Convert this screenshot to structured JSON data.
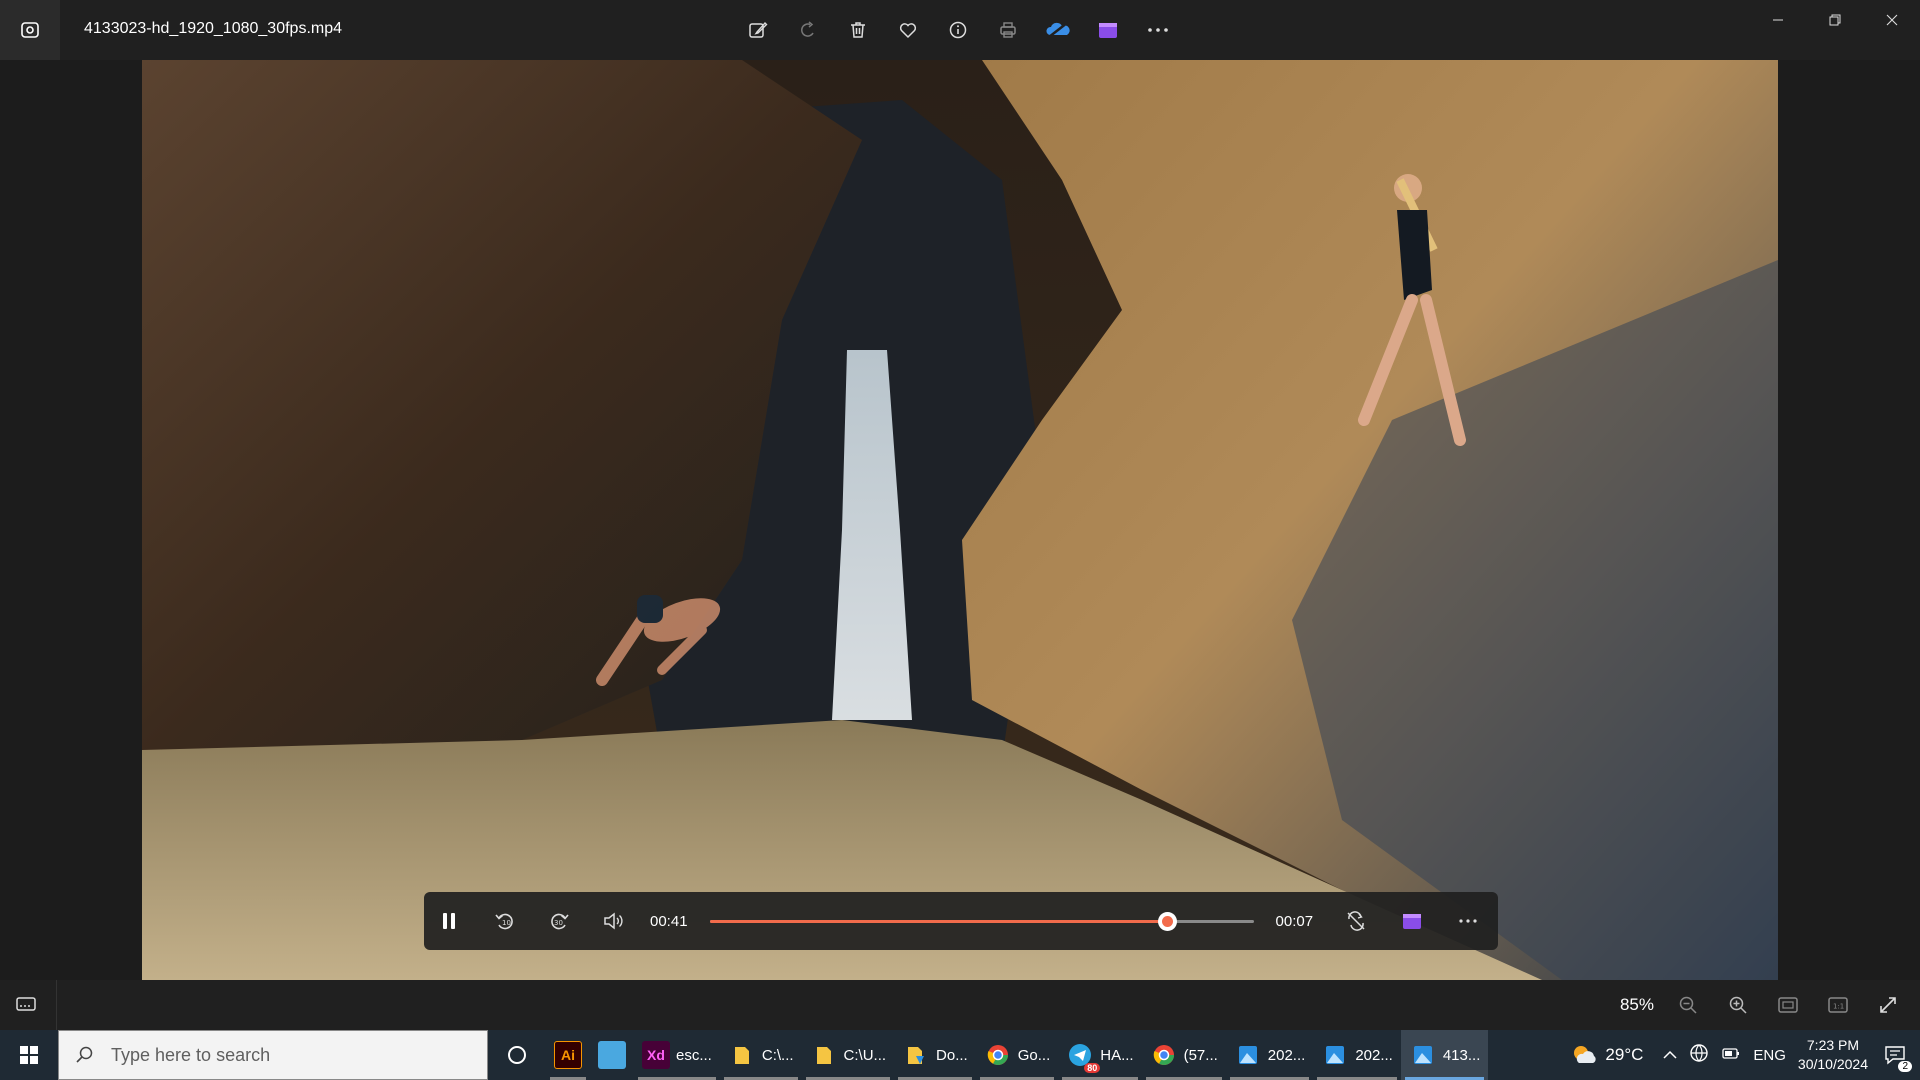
{
  "window": {
    "title": "4133023-hd_1920_1080_30fps.mp4"
  },
  "toolbar": {
    "icons": [
      "edit-image-icon",
      "rotate-icon",
      "delete-icon",
      "favorite-icon",
      "info-icon",
      "print-icon",
      "onedrive-icon",
      "clipchamp-icon",
      "more-icon"
    ]
  },
  "player": {
    "elapsed": "00:41",
    "remaining": "00:07",
    "progress": 0.84
  },
  "statusbar": {
    "zoom": "85%"
  },
  "taskbar": {
    "search_placeholder": "Type here to search",
    "apps": [
      {
        "label": "",
        "name": "cortana",
        "color": ""
      },
      {
        "label": "",
        "name": "illustrator",
        "color": "#f79500"
      },
      {
        "label": "",
        "name": "explorer-card",
        "color": "#4aa8e0"
      },
      {
        "label": "esc...",
        "name": "xd",
        "color": "#ff61f6"
      },
      {
        "label": "C:\\...",
        "name": "folder-1",
        "color": "#f5c542"
      },
      {
        "label": "C:\\U...",
        "name": "folder-2",
        "color": "#f5c542"
      },
      {
        "label": "Do...",
        "name": "folder-3",
        "color": "#f5c542"
      },
      {
        "label": "Go...",
        "name": "chrome-1",
        "color": "#34a853"
      },
      {
        "label": "HA...",
        "name": "telegram",
        "color": "#2aa3e0",
        "badge": "80"
      },
      {
        "label": "(57...",
        "name": "chrome-2",
        "color": "#34a853"
      },
      {
        "label": "202...",
        "name": "photos-1",
        "color": "#2b8fe0"
      },
      {
        "label": "202...",
        "name": "photos-2",
        "color": "#2b8fe0"
      },
      {
        "label": "413...",
        "name": "photos-3",
        "color": "#2b8fe0",
        "active": true
      }
    ],
    "weather": "29°C",
    "language": "ENG",
    "time": "7:23 PM",
    "date": "30/10/2024",
    "notifications": "2"
  }
}
